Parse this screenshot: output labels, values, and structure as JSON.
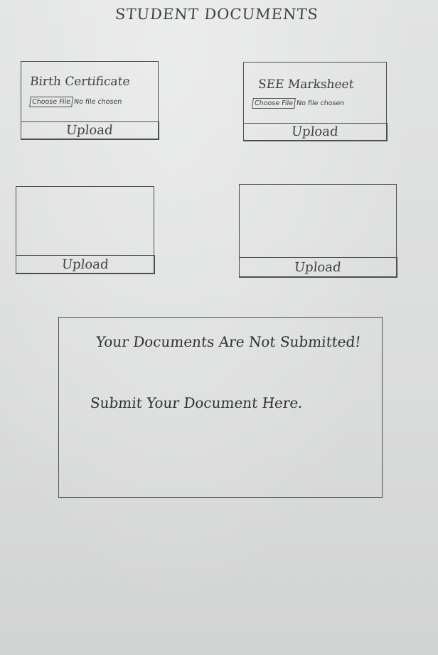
{
  "page": {
    "title": "STUDENT DOCUMENTS"
  },
  "cards": [
    {
      "label": "Birth Certificate",
      "choose_label": "Choose File",
      "status_text": "No file chosen",
      "upload_label": "Upload"
    },
    {
      "label": "SEE Marksheet",
      "choose_label": "Choose File",
      "status_text": "No file chosen",
      "upload_label": "Upload"
    },
    {
      "label": "",
      "upload_label": "Upload"
    },
    {
      "label": "",
      "upload_label": "Upload"
    }
  ],
  "message": {
    "line1": "Your Documents Are Not Submitted!",
    "line2": "Submit Your Document Here."
  }
}
